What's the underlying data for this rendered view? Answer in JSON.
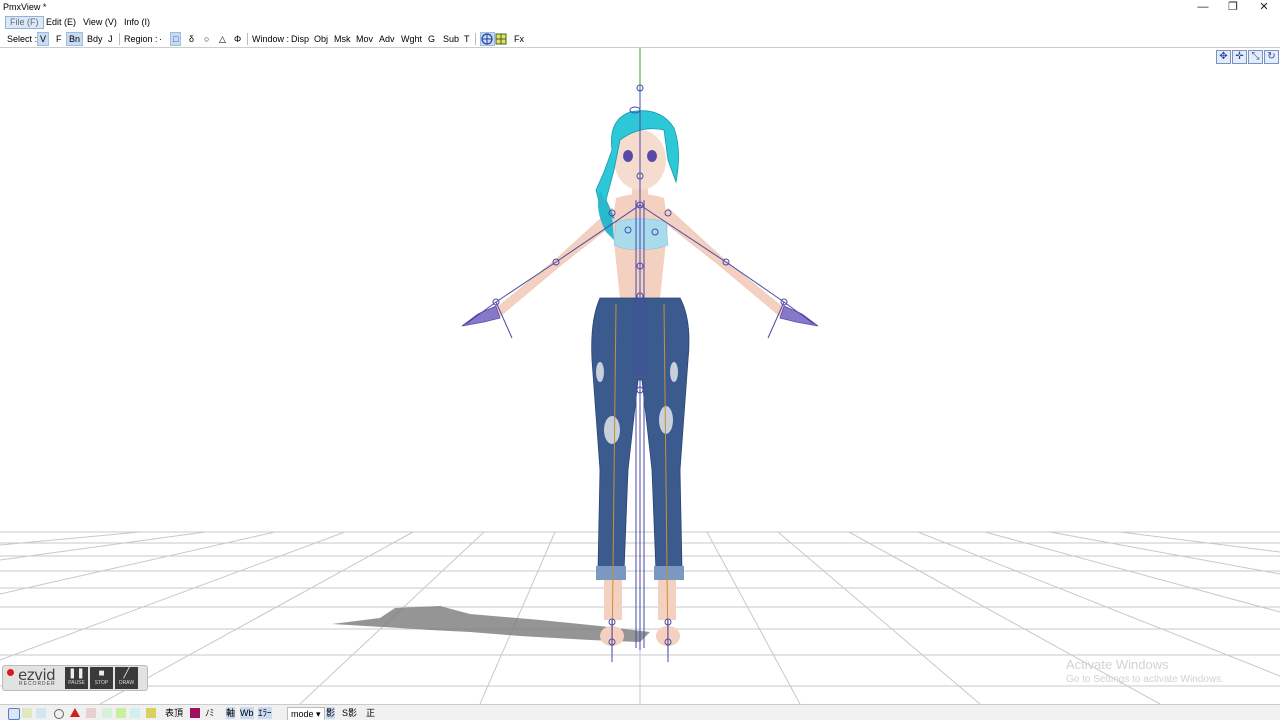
{
  "window": {
    "title": "PmxView *",
    "min": "—",
    "restore": "❐",
    "close": "✕"
  },
  "menu": [
    "File (F)",
    "Edit (E)",
    "View (V)",
    "Info (I)"
  ],
  "toolbar": {
    "select_label": "Select :",
    "select_items": [
      "V",
      "F",
      "Bn",
      "Bdy",
      "J"
    ],
    "region_label": "Region :",
    "region_items": [
      "·",
      "□",
      "δ",
      "○",
      "△",
      "Φ"
    ],
    "window_label": "Window :",
    "window_items": [
      "Disp",
      "Obj",
      "Msk",
      "Mov",
      "Adv",
      "Wght",
      "G",
      "Sub",
      "T"
    ],
    "fx_label": "Fx"
  },
  "colors": {
    "accent": "#c9dbf2",
    "bone": "#4a4aa8",
    "skin": "#f4d0c0",
    "hair": "#2cc8d8",
    "denim": "#3b5b8e",
    "grid": "#c8c8c8"
  },
  "watermark": {
    "line1": "Activate Windows",
    "line2": "Go to Settings to activate Windows."
  },
  "recorder": {
    "logo": "ezvid",
    "sub": "RECORDER",
    "pause": "PAUSE",
    "stop": "STOP",
    "draw": "DRAW"
  },
  "status": {
    "t1": "表頂",
    "t2": "ﾉﾐ",
    "t3": "軸",
    "t4": "Wb",
    "t5": "ｴﾗｰ",
    "mode": "mode",
    "t6": "影",
    "t7": "S影",
    "t8": "正"
  }
}
